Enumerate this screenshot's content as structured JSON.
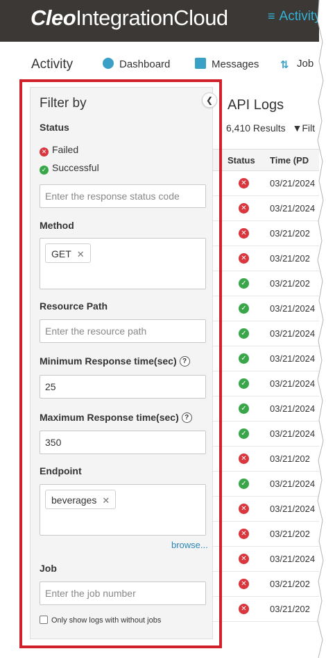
{
  "header": {
    "brand_bold": "Cleo",
    "brand_rest": "IntegrationCloud",
    "active_section": "Activity",
    "active_icon": "activity-icon"
  },
  "subnav": {
    "title": "Activity",
    "items": [
      {
        "label": "Dashboard",
        "icon": "dashboard-icon"
      },
      {
        "label": "Messages",
        "icon": "messages-icon"
      },
      {
        "label": "Job",
        "icon": "jobs-icon"
      }
    ]
  },
  "filter": {
    "title": "Filter by",
    "status_label": "Status",
    "status_options": [
      {
        "label": "Failed",
        "icon": "failed-icon"
      },
      {
        "label": "Successful",
        "icon": "success-icon"
      }
    ],
    "status_code_placeholder": "Enter the response status code",
    "method_label": "Method",
    "method_tags": [
      "GET"
    ],
    "resource_path_label": "Resource Path",
    "resource_path_placeholder": "Enter the resource path",
    "min_response_label": "Minimum Response time(sec)",
    "min_response_value": "25",
    "max_response_label": "Maximum Response time(sec)",
    "max_response_value": "350",
    "endpoint_label": "Endpoint",
    "endpoint_tags": [
      "beverages"
    ],
    "browse_link": "browse...",
    "job_label": "Job",
    "job_placeholder": "Enter the job number",
    "only_without_jobs_label": "Only show logs with without jobs",
    "only_without_jobs_checked": false
  },
  "logs": {
    "title": "API Logs",
    "results": "6,410 Results",
    "filter_label": "Filt",
    "columns": [
      "Status",
      "Time (PD"
    ],
    "rows": [
      {
        "status": "failed",
        "time": "03/21/2024"
      },
      {
        "status": "failed",
        "time": "03/21/2024"
      },
      {
        "status": "failed",
        "time": "03/21/202"
      },
      {
        "status": "failed",
        "time": "03/21/202"
      },
      {
        "status": "success",
        "time": "03/21/202"
      },
      {
        "status": "success",
        "time": "03/21/2024"
      },
      {
        "status": "success",
        "time": "03/21/2024"
      },
      {
        "status": "success",
        "time": "03/21/2024"
      },
      {
        "status": "success",
        "time": "03/21/2024"
      },
      {
        "status": "success",
        "time": "03/21/2024"
      },
      {
        "status": "success",
        "time": "03/21/2024"
      },
      {
        "status": "failed",
        "time": "03/21/202"
      },
      {
        "status": "success",
        "time": "03/21/2024"
      },
      {
        "status": "failed",
        "time": "03/21/2024"
      },
      {
        "status": "failed",
        "time": "03/21/202"
      },
      {
        "status": "failed",
        "time": "03/21/2024"
      },
      {
        "status": "failed",
        "time": "03/21/202"
      },
      {
        "status": "failed",
        "time": "03/21/202"
      }
    ]
  },
  "colors": {
    "header_bg": "#3c3835",
    "accent": "#32b4d6",
    "failed": "#d9363e",
    "success": "#3aa64a",
    "highlight": "#d0212a"
  }
}
